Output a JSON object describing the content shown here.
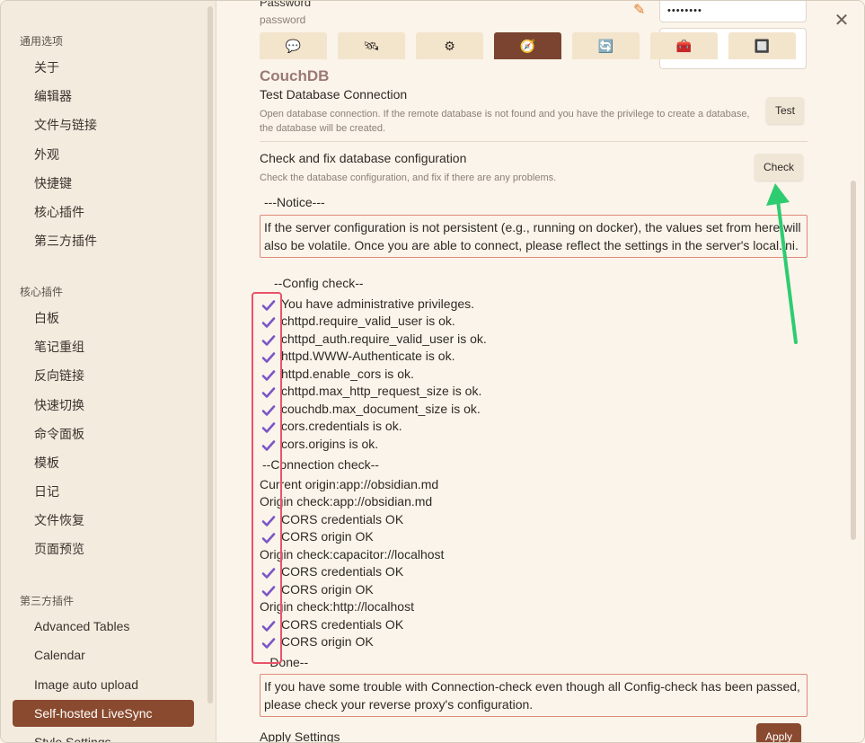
{
  "sidebar": {
    "groups": [
      {
        "label": "通用选项",
        "items": [
          "关于",
          "编辑器",
          "文件与链接",
          "外观",
          "快捷键",
          "核心插件",
          "第三方插件"
        ]
      },
      {
        "label": "核心插件",
        "items": [
          "白板",
          "笔记重组",
          "反向链接",
          "快速切换",
          "命令面板",
          "模板",
          "日记",
          "文件恢复",
          "页面预览"
        ]
      },
      {
        "label": "第三方插件",
        "items": [
          "Advanced Tables",
          "Calendar",
          "Image auto upload",
          "Self-hosted LiveSync",
          "Style Settings"
        ]
      }
    ],
    "active": "Self-hosted LiveSync"
  },
  "main": {
    "password_label": "Password",
    "password_sub": "password",
    "password_value": "••••••••",
    "tab_icons": [
      "💬",
      "🛰",
      "⚙",
      "🧭",
      "🔄",
      "🧰",
      "🔲"
    ],
    "section_title": "CouchDB",
    "test_db": {
      "name": "Test Database Connection",
      "desc": "Open database connection. If the remote database is not found and you have the privilege to create a database, the database will be created.",
      "button": "Test"
    },
    "check_db": {
      "name": "Check and fix database configuration",
      "desc": "Check the database configuration, and fix if there are any problems.",
      "button": "Check"
    },
    "notice_header": "---Notice---",
    "notice_text": "If the server configuration is not persistent (e.g., running on docker), the values set from here will also be volatile. Once you are able to connect, please reflect the settings in the server's local.ini.",
    "config_header": "--Config check--",
    "config_items": [
      "You have administrative privileges.",
      "chttpd.require_valid_user is ok.",
      "chttpd_auth.require_valid_user is ok.",
      "httpd.WWW-Authenticate is ok.",
      "httpd.enable_cors is ok.",
      "chttpd.max_http_request_size is ok.",
      "couchdb.max_document_size is ok.",
      "cors.credentials is ok.",
      "cors.origins is ok."
    ],
    "connection_header": "--Connection check--",
    "current_origin": "Current origin:app://obsidian.md",
    "origin1": "Origin check:app://obsidian.md",
    "origin2": "Origin check:capacitor://localhost",
    "origin3": "Origin check:http://localhost",
    "cors_credentials": "CORS credentials OK",
    "cors_origin": "CORS origin OK",
    "done": "--Done--",
    "trouble_text": "If you have some trouble with Connection-check even though all Config-check has been passed, please check your reverse proxy's configuration.",
    "apply_label": "Apply Settings",
    "apply_button": "Apply"
  },
  "colors": {
    "accent": "#8a4a2f",
    "check": "#7b55c7",
    "annotation_red": "#e8546a",
    "annotation_green": "#2ecc71"
  }
}
